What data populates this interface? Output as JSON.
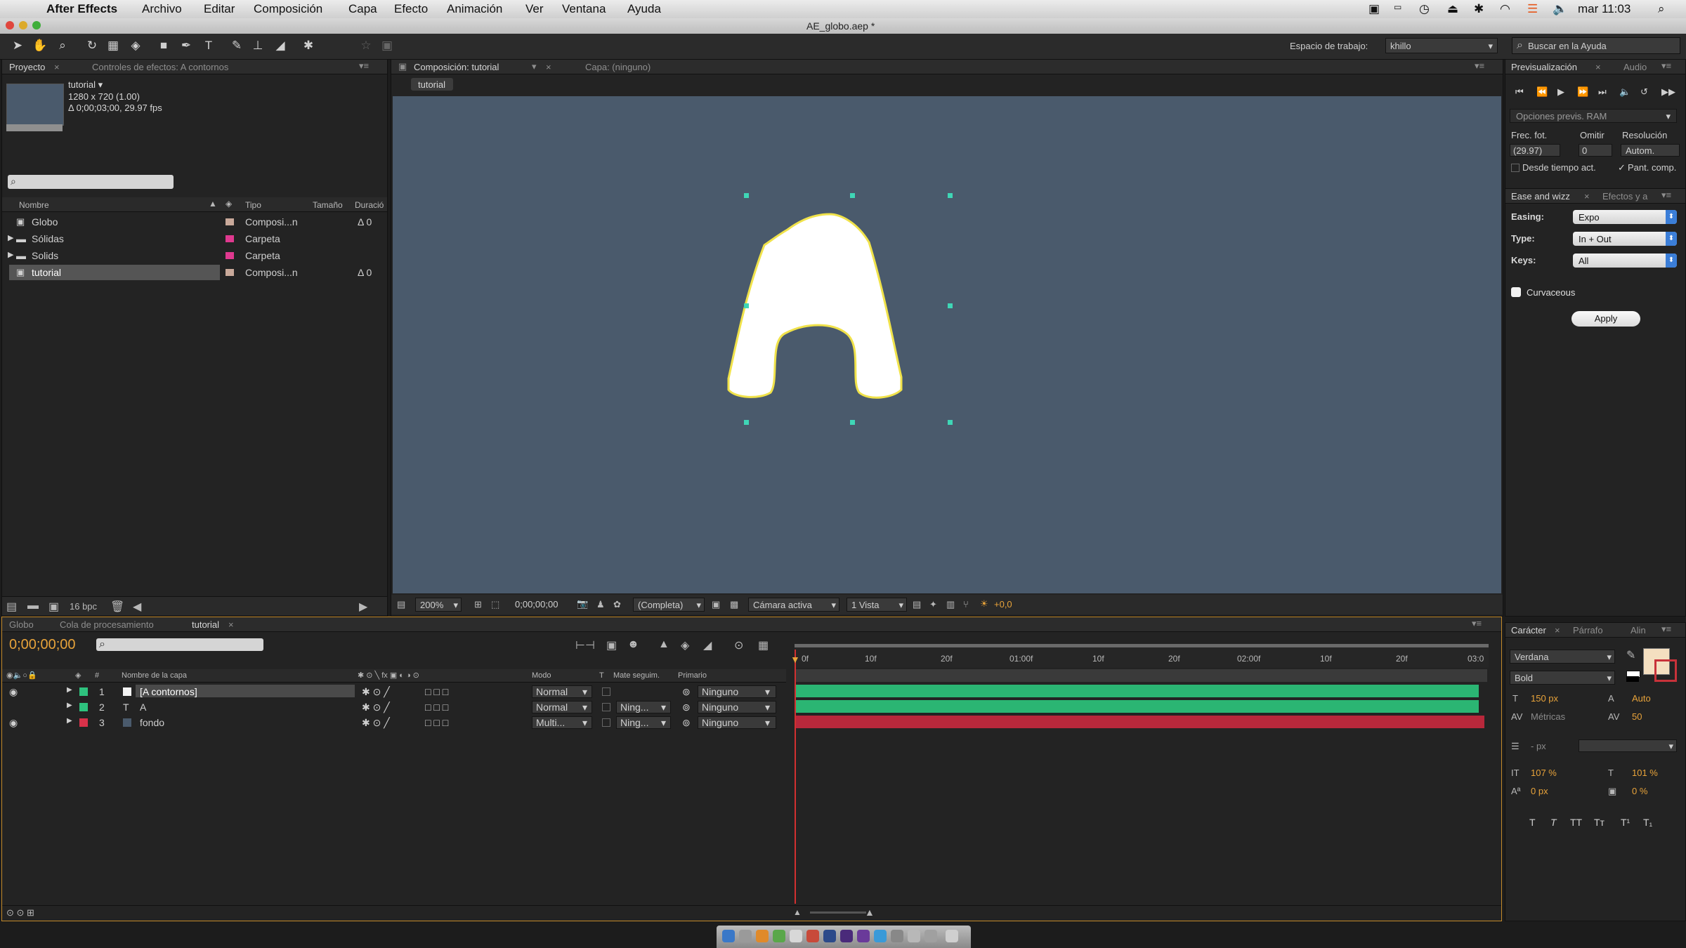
{
  "menubar": {
    "app_name": "After Effects",
    "items": [
      "Archivo",
      "Editar",
      "Composición",
      "Capa",
      "Efecto",
      "Animación",
      "Ver",
      "Ventana",
      "Ayuda"
    ],
    "clock": "mar 11:03"
  },
  "window": {
    "title": "AE_globo.aep *"
  },
  "toolbar": {
    "workspace_label": "Espacio de trabajo:",
    "workspace_value": "khillo",
    "help_search_placeholder": "Buscar en la Ayuda"
  },
  "project_panel": {
    "tabs": [
      "Proyecto",
      "Controles de efectos: A contornos"
    ],
    "comp_name": "tutorial ▾",
    "comp_size": "1280 x 720 (1.00)",
    "comp_duration": "Δ 0;00;03;00, 29.97 fps",
    "columns": [
      "Nombre",
      "Tipo",
      "Tamaño",
      "Duració"
    ],
    "items": [
      {
        "name": "Globo",
        "type": "Composi...n",
        "duration": "Δ 0",
        "color": "#c9a99a"
      },
      {
        "name": "Sólidas",
        "type": "Carpeta",
        "duration": "",
        "color": "#e0398f"
      },
      {
        "name": "Solids",
        "type": "Carpeta",
        "duration": "",
        "color": "#e0398f"
      },
      {
        "name": "tutorial",
        "type": "Composi...n",
        "duration": "Δ 0",
        "color": "#c9a99a"
      }
    ],
    "bpc": "16 bpc"
  },
  "comp_panel": {
    "tabs": [
      "Composición: tutorial",
      "Capa: (ninguno)"
    ],
    "breadcrumb": "tutorial",
    "zoom": "200%",
    "timecode": "0;00;00;00",
    "resolution": "(Completa)",
    "camera": "Cámara activa",
    "views": "1 Vista",
    "exposure": "+0,0"
  },
  "preview_panel": {
    "tabs": [
      "Previsualización",
      "Audio"
    ],
    "ram_options": "Opciones previs. RAM",
    "frame_rate_label": "Frec. fot.",
    "skip_label": "Omitir",
    "resolution_label": "Resolución",
    "frame_rate_value": "(29.97)",
    "skip_value": "0",
    "resolution_value": "Autom.",
    "from_current": "Desde tiempo act.",
    "full_screen": "Pant. comp."
  },
  "ease_panel": {
    "tabs": [
      "Ease and wizz",
      "Efectos y a"
    ],
    "easing_label": "Easing:",
    "easing_value": "Expo",
    "type_label": "Type:",
    "type_value": "In + Out",
    "keys_label": "Keys:",
    "keys_value": "All",
    "curvaceous": "Curvaceous",
    "apply": "Apply"
  },
  "timeline": {
    "tabs": [
      "Globo",
      "Cola de procesamiento",
      "tutorial"
    ],
    "timecode": "0;00;00;00",
    "header": {
      "layer_name": "Nombre de la capa",
      "mode": "Modo",
      "t": "T",
      "matte": "Mate seguim.",
      "parent": "Primario",
      "num": "#"
    },
    "ruler": [
      "0f",
      "10f",
      "20f",
      "01:00f",
      "10f",
      "20f",
      "02:00f",
      "10f",
      "20f",
      "03:0"
    ],
    "layers": [
      {
        "num": "1",
        "name": "[A contornos]",
        "mode": "Normal",
        "matte": "",
        "parent": "Ninguno",
        "color": "#2ec27e",
        "bar": "#2bb573"
      },
      {
        "num": "2",
        "name": "A",
        "mode": "Normal",
        "matte": "Ning...",
        "parent": "Ninguno",
        "color": "#2ec27e",
        "bar": "#2bb573"
      },
      {
        "num": "3",
        "name": "fondo",
        "mode": "Multi...",
        "matte": "Ning...",
        "parent": "Ninguno",
        "color": "#d8324a",
        "bar": "#b8283b"
      }
    ]
  },
  "character_panel": {
    "tabs": [
      "Carácter",
      "Párrafo",
      "Alin"
    ],
    "font": "Verdana",
    "style": "Bold",
    "size": "150 px",
    "leading": "Auto",
    "kerning": "Métricas",
    "tracking": "50",
    "stroke": "- px",
    "vscale": "107 %",
    "hscale": "101 %",
    "baseline": "0 px",
    "tsume": "0 %"
  },
  "colors": {
    "accent": "#e8a33a",
    "viewer_bg": "#4a5a6c",
    "handle": "#3fd6b6",
    "shape_stroke": "#f0e24a"
  }
}
